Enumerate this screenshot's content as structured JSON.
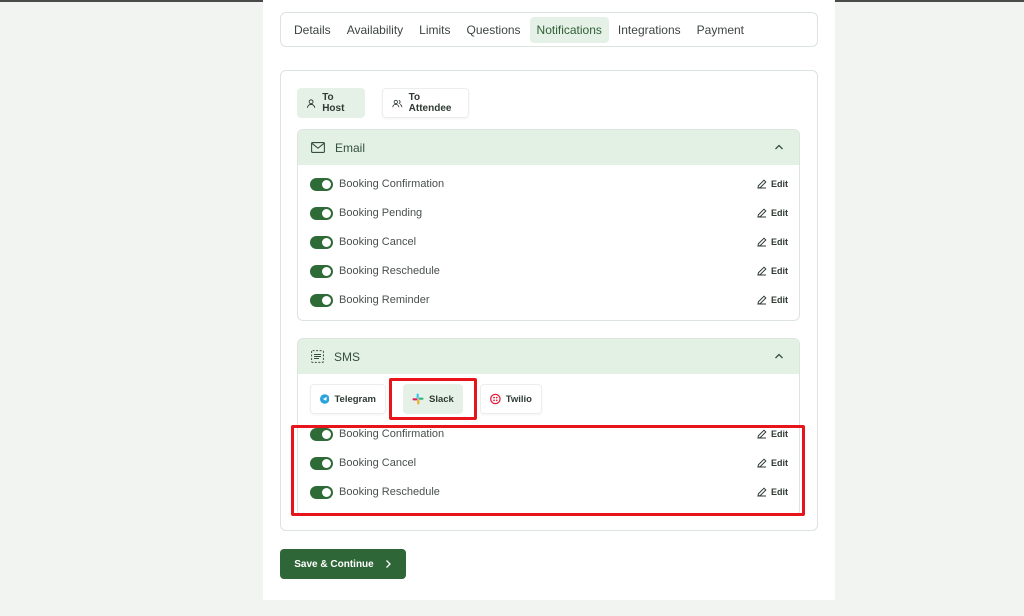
{
  "tabs": [
    "Details",
    "Availability",
    "Limits",
    "Questions",
    "Notifications",
    "Integrations",
    "Payment"
  ],
  "active_tab": "Notifications",
  "recipients": {
    "host": "To Host",
    "attendee": "To Attendee"
  },
  "email": {
    "title": "Email",
    "items": [
      {
        "label": "Booking Confirmation",
        "enabled": true
      },
      {
        "label": "Booking Pending",
        "enabled": true
      },
      {
        "label": "Booking Cancel",
        "enabled": true
      },
      {
        "label": "Booking Reschedule",
        "enabled": true
      },
      {
        "label": "Booking Reminder",
        "enabled": true
      }
    ]
  },
  "sms": {
    "title": "SMS",
    "providers": [
      "Telegram",
      "Slack",
      "Twilio"
    ],
    "active_provider": "Slack",
    "items": [
      {
        "label": "Booking Confirmation",
        "enabled": true
      },
      {
        "label": "Booking Cancel",
        "enabled": true
      },
      {
        "label": "Booking Reschedule",
        "enabled": true
      }
    ]
  },
  "edit_label": "Edit",
  "save_label": "Save & Continue",
  "colors": {
    "accent": "#2f6638",
    "accent_light": "#e3f1e4",
    "highlight": "#e8141c"
  }
}
